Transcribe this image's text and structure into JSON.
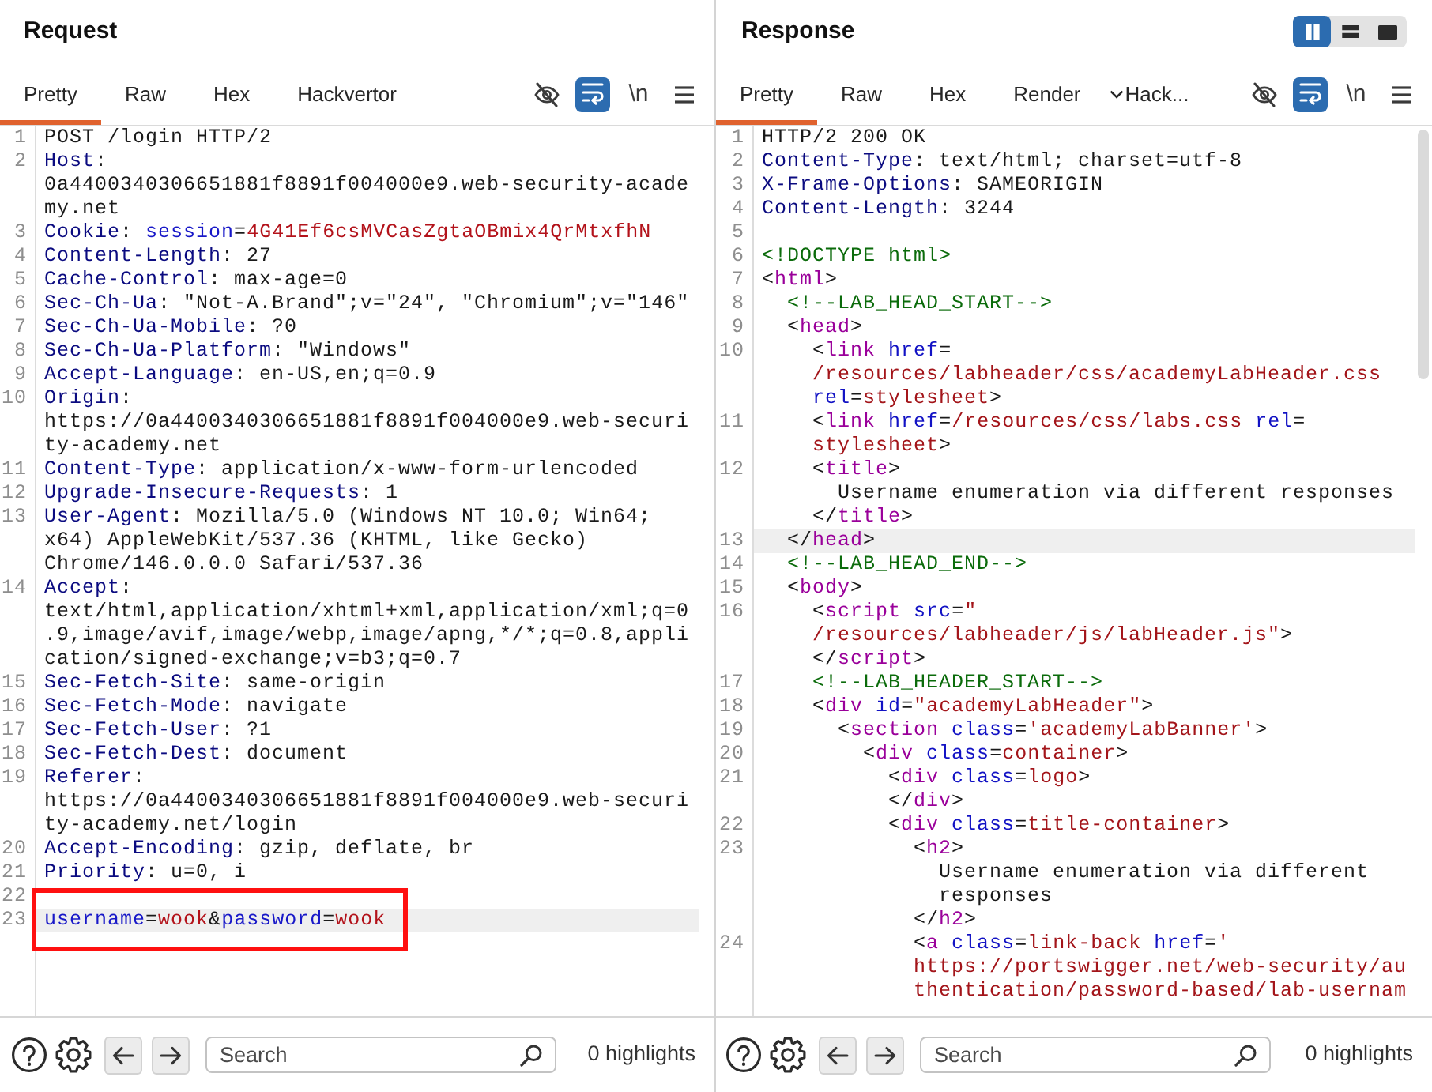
{
  "panes": [
    {
      "title": "Request",
      "tabs": [
        {
          "label": "Pretty",
          "selected": true
        },
        {
          "label": "Raw",
          "selected": false
        },
        {
          "label": "Hex",
          "selected": false
        },
        {
          "label": "Hackvertor",
          "selected": false
        }
      ],
      "toggles": [
        {
          "kind": "eye-slash",
          "on": false
        },
        {
          "kind": "wrap",
          "on": true
        },
        {
          "kind": "newline",
          "label": "\\n",
          "on": false
        }
      ],
      "lines": [
        {
          "number": "1",
          "kind": "start",
          "segments": [
            "POST /login HTTP/2"
          ],
          "selected": false,
          "boxed": false
        },
        {
          "number": "2",
          "kind": "header",
          "segments": [
            "Host: 0a4400340306651881f8891f004000e9.web-security-academy.net"
          ],
          "selected": false,
          "boxed": false
        },
        {
          "number": "3",
          "kind": "cookie",
          "segments": [
            "Cookie: session=4G41Ef6csMVCasZgtaOBmix4QrMtxfhN"
          ],
          "selected": false,
          "boxed": false
        },
        {
          "number": "4",
          "kind": "header",
          "segments": [
            "Content-Length: 27"
          ],
          "selected": false,
          "boxed": false
        },
        {
          "number": "5",
          "kind": "header",
          "segments": [
            "Cache-Control: max-age=0"
          ],
          "selected": false,
          "boxed": false
        },
        {
          "number": "6",
          "kind": "header",
          "segments": [
            "Sec-Ch-Ua: \"Not-A.Brand\";v=\"24\", \"Chromium\";v=\"146\""
          ],
          "selected": false,
          "boxed": false
        },
        {
          "number": "7",
          "kind": "header",
          "segments": [
            "Sec-Ch-Ua-Mobile: ?0"
          ],
          "selected": false,
          "boxed": false
        },
        {
          "number": "8",
          "kind": "header",
          "segments": [
            "Sec-Ch-Ua-Platform: \"Windows\""
          ],
          "selected": false,
          "boxed": false
        },
        {
          "number": "9",
          "kind": "header",
          "segments": [
            "Accept-Language: en-US,en;q=0.9"
          ],
          "selected": false,
          "boxed": false
        },
        {
          "number": "10",
          "kind": "header",
          "segments": [
            "Origin: https://0a4400340306651881f8891f004000e9.web-security-academy.net"
          ],
          "selected": false,
          "boxed": false
        },
        {
          "number": "11",
          "kind": "header",
          "segments": [
            "Content-Type: application/x-www-form-urlencoded"
          ],
          "selected": false,
          "boxed": false
        },
        {
          "number": "12",
          "kind": "header",
          "segments": [
            "Upgrade-Insecure-Requests: 1"
          ],
          "selected": false,
          "boxed": false
        },
        {
          "number": "13",
          "kind": "header",
          "segments": [
            "User-Agent: Mozilla/5.0 (Windows NT 10.0; Win64; x64) AppleWebKit/537.36 (KHTML, like Gecko) Chrome/146.0.0.0 Safari/537.36"
          ],
          "selected": false,
          "boxed": false
        },
        {
          "number": "14",
          "kind": "header",
          "segments": [
            "Accept: text/html,application/xhtml+xml,application/xml;q=0.9,image/avif,image/webp,image/apng,*/*;q=0.8,application/signed-exchange;v=b3;q=0.7"
          ],
          "selected": false,
          "boxed": false
        },
        {
          "number": "15",
          "kind": "header",
          "segments": [
            "Sec-Fetch-Site: same-origin"
          ],
          "selected": false,
          "boxed": false
        },
        {
          "number": "16",
          "kind": "header",
          "segments": [
            "Sec-Fetch-Mode: navigate"
          ],
          "selected": false,
          "boxed": false
        },
        {
          "number": "17",
          "kind": "header",
          "segments": [
            "Sec-Fetch-User: ?1"
          ],
          "selected": false,
          "boxed": false
        },
        {
          "number": "18",
          "kind": "header",
          "segments": [
            "Sec-Fetch-Dest: document"
          ],
          "selected": false,
          "boxed": false
        },
        {
          "number": "19",
          "kind": "header",
          "segments": [
            "Referer: https://0a4400340306651881f8891f004000e9.web-security-academy.net/login"
          ],
          "selected": false,
          "boxed": false
        },
        {
          "number": "20",
          "kind": "header",
          "segments": [
            "Accept-Encoding: gzip, deflate, br"
          ],
          "selected": false,
          "boxed": false
        },
        {
          "number": "21",
          "kind": "header",
          "segments": [
            "Priority: u=0, i"
          ],
          "selected": false,
          "boxed": false
        },
        {
          "number": "22",
          "selected": false,
          "boxed": false
        },
        {
          "number": "23",
          "kind": "params",
          "segments": [
            "username=wook&password=wook"
          ],
          "selected": true,
          "boxed": true
        }
      ],
      "search": {
        "placeholder": "Search"
      },
      "highlights": "0 highlights"
    },
    {
      "title": "Response",
      "layout_buttons": [
        {
          "kind": "columns",
          "selected": true
        },
        {
          "kind": "rows",
          "selected": false
        },
        {
          "kind": "single",
          "selected": false
        }
      ],
      "tabs": [
        {
          "label": "Pretty",
          "selected": true,
          "dropdown": false
        },
        {
          "label": "Raw",
          "selected": false,
          "dropdown": false
        },
        {
          "label": "Hex",
          "selected": false,
          "dropdown": false
        },
        {
          "label": "Render",
          "selected": false,
          "dropdown": false
        },
        {
          "label": "Hack...",
          "selected": false,
          "dropdown": true
        }
      ],
      "toggles": [
        {
          "kind": "eye-slash",
          "on": false
        },
        {
          "kind": "wrap",
          "on": true
        },
        {
          "kind": "newline",
          "label": "\\n",
          "on": false
        }
      ],
      "lines": [
        {
          "number": "1",
          "kind": "start",
          "segments": [
            "HTTP/2 200 OK"
          ],
          "selected": false
        },
        {
          "number": "2",
          "kind": "header",
          "segments": [
            "Content-Type: text/html; charset=utf-8"
          ],
          "selected": false
        },
        {
          "number": "3",
          "kind": "header",
          "segments": [
            "X-Frame-Options: SAMEORIGIN"
          ],
          "selected": false
        },
        {
          "number": "4",
          "kind": "header",
          "segments": [
            "Content-Length: 3244"
          ],
          "selected": false
        },
        {
          "number": "5",
          "selected": false
        },
        {
          "number": "6",
          "kind": "html",
          "segments": [
            "<!DOCTYPE html>"
          ],
          "selected": false
        },
        {
          "number": "7",
          "kind": "html",
          "segments": [
            "<html>"
          ],
          "selected": false
        },
        {
          "number": "8",
          "kind": "html",
          "segments": [
            "  <!--LAB_HEAD_START-->"
          ],
          "selected": false
        },
        {
          "number": "9",
          "kind": "html",
          "segments": [
            "  <head>"
          ],
          "selected": false
        },
        {
          "number": "10",
          "kind": "html",
          "segments": [
            "    <link href=/resources/labheader/css/academyLabHeader.css rel=stylesheet>"
          ],
          "selected": false
        },
        {
          "number": "11",
          "kind": "html",
          "segments": [
            "    <link href=/resources/css/labs.css rel=",
            "    stylesheet>"
          ],
          "selected": false
        },
        {
          "number": "12",
          "kind": "html",
          "segments": [
            "    <title>",
            "      Username enumeration via different responses",
            "    </title>"
          ],
          "selected": false
        },
        {
          "number": "13",
          "kind": "html",
          "segments": [
            "  </head>"
          ],
          "selected": true
        },
        {
          "number": "14",
          "kind": "html",
          "segments": [
            "  <!--LAB_HEAD_END-->"
          ],
          "selected": false
        },
        {
          "number": "15",
          "kind": "html",
          "segments": [
            "  <body>"
          ],
          "selected": false
        },
        {
          "number": "16",
          "kind": "html",
          "segments": [
            "    <script src=\"/resources/labheader/js/labHeader.js\">",
            "    </script>"
          ],
          "selected": false
        },
        {
          "number": "17",
          "kind": "html",
          "segments": [
            "    <!--LAB_HEADER_START-->"
          ],
          "selected": false
        },
        {
          "number": "18",
          "kind": "html",
          "segments": [
            "    <div id=\"academyLabHeader\">"
          ],
          "selected": false
        },
        {
          "number": "19",
          "kind": "html",
          "segments": [
            "      <section class='academyLabBanner'>"
          ],
          "selected": false
        },
        {
          "number": "20",
          "kind": "html",
          "segments": [
            "        <div class=container>"
          ],
          "selected": false
        },
        {
          "number": "21",
          "kind": "html",
          "segments": [
            "          <div class=logo>",
            "          </div>"
          ],
          "selected": false
        },
        {
          "number": "22",
          "kind": "html",
          "segments": [
            "          <div class=title-container>"
          ],
          "selected": false
        },
        {
          "number": "23",
          "kind": "html",
          "segments": [
            "            <h2>",
            "              Username enumeration via different responses",
            "            </h2>"
          ],
          "selected": false
        },
        {
          "number": "24",
          "kind": "html",
          "segments": [
            "            <a class=link-back href='https://portswigger.net/web-security/authentication/password-based/lab-usernam"
          ],
          "selected": false
        }
      ],
      "search": {
        "placeholder": "Search"
      },
      "highlights": "0 highlights"
    }
  ]
}
